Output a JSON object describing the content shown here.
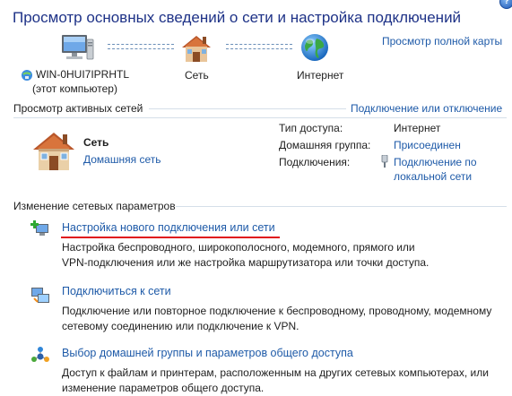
{
  "page": {
    "title": "Просмотр основных сведений о сети и настройка подключений",
    "help_label": "?"
  },
  "network_map": {
    "computer_name": "WIN-0HUI7IPRHTL",
    "computer_sub": "(этот компьютер)",
    "network_label": "Сеть",
    "internet_label": "Интернет",
    "full_map_link": "Просмотр полной карты"
  },
  "active_networks": {
    "header": "Просмотр активных сетей",
    "connect_link": "Подключение или отключение",
    "network_name": "Сеть",
    "network_type": "Домашняя сеть",
    "access_type_key": "Тип доступа:",
    "access_type_val": "Интернет",
    "homegroup_key": "Домашняя группа:",
    "homegroup_val": "Присоединен",
    "connections_key": "Подключения:",
    "connections_val_1": "Подключение по",
    "connections_val_2": "локальной сети"
  },
  "change_settings": {
    "header": "Изменение сетевых параметров",
    "tasks": [
      {
        "icon": "new-connection-icon",
        "title": "Настройка нового подключения или сети",
        "desc_1": "Настройка беспроводного, широкополосного, модемного, прямого или",
        "desc_2": "VPN-подключения или же настройка маршрутизатора или точки доступа."
      },
      {
        "icon": "connect-network-icon",
        "title": "Подключиться к сети",
        "desc_1": "Подключение или повторное подключение к беспроводному, проводному, модемному",
        "desc_2": "сетевому соединению или подключение к VPN."
      },
      {
        "icon": "homegroup-icon",
        "title": "Выбор домашней группы и параметров общего доступа",
        "desc_1": "Доступ к файлам и принтерам, расположенным на других сетевых компьютерах, или",
        "desc_2": "изменение параметров общего доступа."
      }
    ]
  },
  "colors": {
    "title": "#1e3287",
    "link": "#1e5aa8",
    "highlight_underline": "#e0131b"
  }
}
